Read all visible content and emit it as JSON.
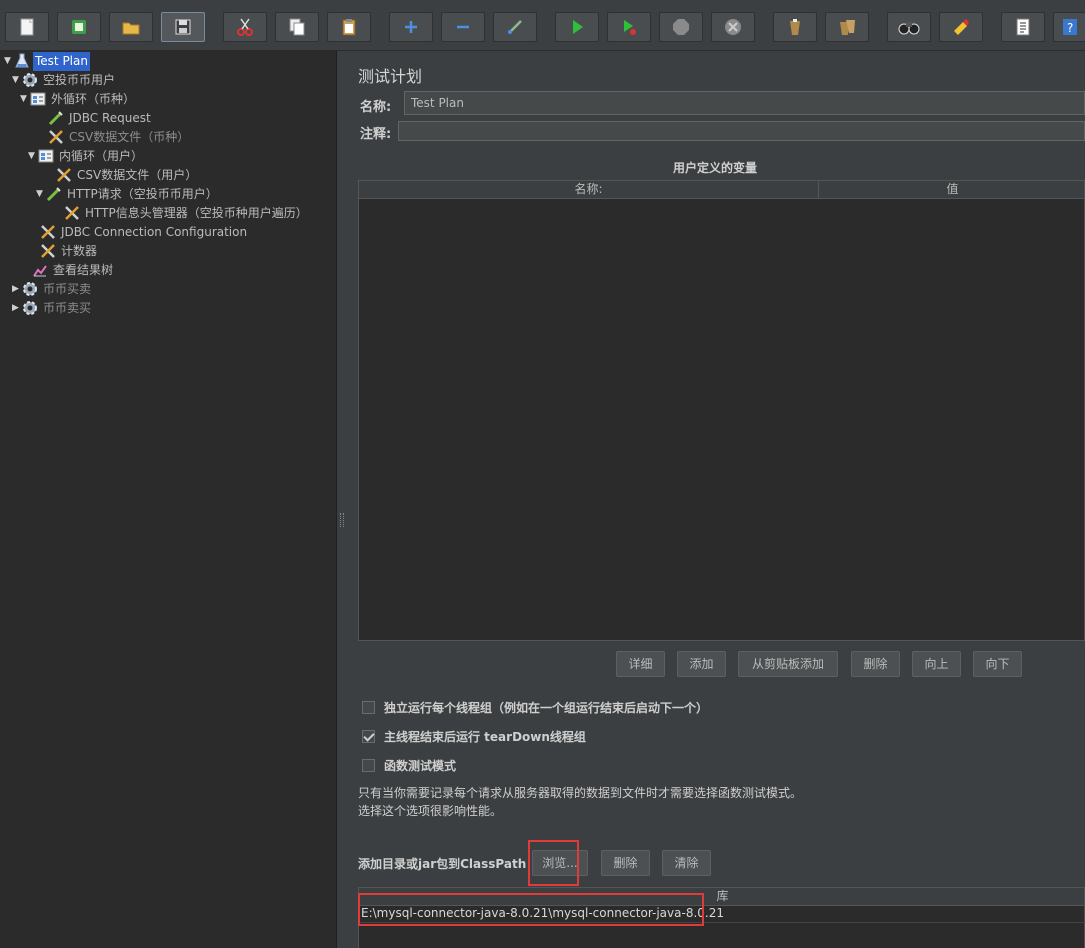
{
  "toolbar": {
    "buttons": [
      {
        "name": "new-icon"
      },
      {
        "name": "templates-icon"
      },
      {
        "name": "open-icon"
      },
      {
        "name": "save-icon"
      },
      {
        "name": "cut-icon"
      },
      {
        "name": "copy-icon"
      },
      {
        "name": "paste-icon"
      },
      {
        "name": "expand-icon"
      },
      {
        "name": "collapse-icon"
      },
      {
        "name": "toggle-icon"
      },
      {
        "name": "start-icon"
      },
      {
        "name": "start-no-pauses-icon"
      },
      {
        "name": "stop-icon"
      },
      {
        "name": "shutdown-icon"
      },
      {
        "name": "clear-icon"
      },
      {
        "name": "clear-all-icon"
      },
      {
        "name": "search-icon"
      },
      {
        "name": "reset-search-icon"
      },
      {
        "name": "function-helper-icon"
      },
      {
        "name": "help-icon"
      }
    ]
  },
  "tree": {
    "items": [
      {
        "label": "Test Plan",
        "icon": "test-plan-icon"
      },
      {
        "label": "空投币币用户",
        "icon": "thread-group-icon"
      },
      {
        "label": "外循环（币种）",
        "icon": "loop-controller-icon"
      },
      {
        "label": "JDBC Request",
        "icon": "sampler-icon"
      },
      {
        "label": "CSV数据文件（币种）",
        "icon": "config-element-icon"
      },
      {
        "label": "内循环（用户）",
        "icon": "loop-controller-icon"
      },
      {
        "label": "CSV数据文件（用户）",
        "icon": "config-element-icon"
      },
      {
        "label": "HTTP请求（空投币币用户）",
        "icon": "sampler-icon"
      },
      {
        "label": "HTTP信息头管理器（空投币种用户遍历）",
        "icon": "config-element-icon"
      },
      {
        "label": "JDBC Connection Configuration",
        "icon": "config-element-icon"
      },
      {
        "label": "计数器",
        "icon": "config-element-icon"
      },
      {
        "label": "查看结果树",
        "icon": "listener-icon"
      },
      {
        "label": "币币买卖",
        "icon": "thread-group-icon"
      },
      {
        "label": "币币卖买",
        "icon": "thread-group-icon"
      }
    ]
  },
  "panel": {
    "title": "测试计划",
    "name_label": "名称:",
    "name_value": "Test Plan",
    "comment_label": "注释:",
    "comment_value": "",
    "variables_title": "用户定义的变量",
    "columns": [
      "名称:",
      "值"
    ],
    "buttons": [
      "详细",
      "添加",
      "从剪贴板添加",
      "删除",
      "向上",
      "向下"
    ],
    "checkboxes": [
      {
        "label": "独立运行每个线程组（例如在一个组运行结束后启动下一个）",
        "checked": false
      },
      {
        "label": "主线程结束后运行 tearDown线程组",
        "checked": true
      },
      {
        "label": "函数测试模式",
        "checked": false
      }
    ],
    "note_line1": "只有当你需要记录每个请求从服务器取得的数据到文件时才需要选择函数测试模式。",
    "note_line2": "选择这个选项很影响性能。",
    "classpath_label": "添加目录或jar包到ClassPath",
    "classpath_buttons": [
      "浏览...",
      "删除",
      "清除"
    ],
    "lib_column": "库",
    "lib_rows": [
      "E:\\mysql-connector-java-8.0.21\\mysql-connector-java-8.0.21"
    ]
  },
  "colors": {
    "background": "#3c3f41",
    "tree_background": "#2b2b2b",
    "selection": "#2f65ca",
    "highlight": "#e03b3b"
  }
}
